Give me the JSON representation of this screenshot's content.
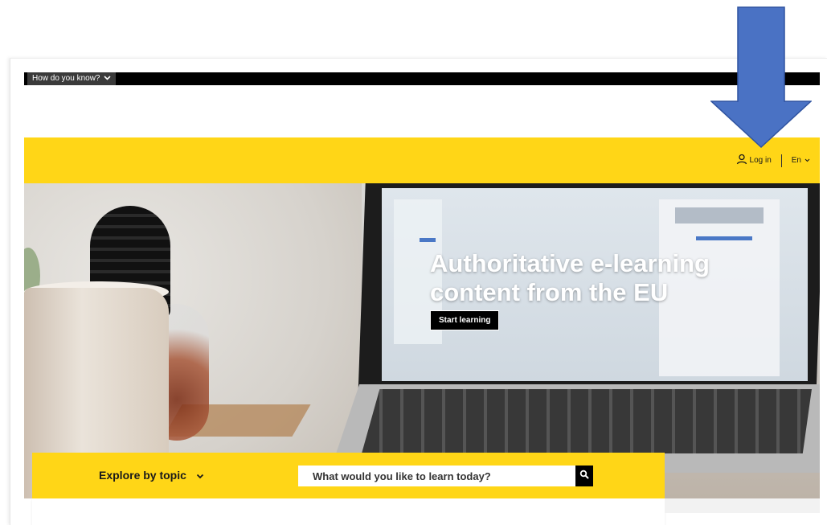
{
  "top_bar": {
    "toggle_label": "How do you know?"
  },
  "header": {
    "login_label": "Log in",
    "language_label": "En"
  },
  "hero": {
    "title": "Authoritative e-learning content from the EU",
    "cta_label": "Start learning"
  },
  "explore_bar": {
    "topic_label": "Explore by topic",
    "search_placeholder": "What would you like to learn today?"
  },
  "colors": {
    "accent_yellow": "#ffd617",
    "annotation_arrow": "#4a72c4"
  },
  "icons": {
    "toggle": "chevron-down-icon",
    "login": "user-icon",
    "language": "chevron-down-icon",
    "explore": "chevron-down-icon",
    "search": "search-icon",
    "annotation": "arrow-down-icon"
  }
}
